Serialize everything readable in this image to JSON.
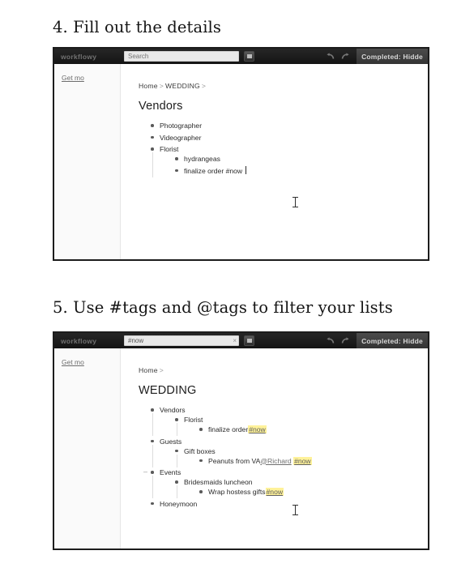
{
  "document": {
    "steps": [
      {
        "heading": "4. Fill out the details"
      },
      {
        "heading": "5. Use #tags and @tags to filter your lists"
      }
    ]
  },
  "screenshot_1": {
    "topbar": {
      "logo": "workflowy",
      "search_value": "",
      "search_placeholder": "Search",
      "search_clear_label": "",
      "undo_icon": "undo-arrow-icon",
      "redo_icon": "redo-arrow-icon",
      "menu_button_icon": "square-menu-icon",
      "completed_button": "Completed: Hidde"
    },
    "sidebar": {
      "link": "Get mo"
    },
    "breadcrumb": {
      "items": [
        "Home",
        "WEDDING"
      ],
      "separator": ">"
    },
    "title": "Vendors",
    "outline": [
      {
        "text": "Photographer",
        "indent": 0
      },
      {
        "text": "Videographer",
        "indent": 0
      },
      {
        "text": "Florist",
        "indent": 0
      },
      {
        "text": "hydrangeas",
        "indent": 1
      },
      {
        "text": "finalize order #now",
        "indent": 1,
        "caret": true
      }
    ]
  },
  "screenshot_2": {
    "topbar": {
      "logo": "workflowy",
      "search_value": "#now",
      "search_placeholder": "Search",
      "search_clear_label": "×",
      "undo_icon": "undo-arrow-icon",
      "redo_icon": "redo-arrow-icon",
      "menu_button_icon": "square-menu-icon",
      "completed_button": "Completed: Hidde"
    },
    "sidebar": {
      "link": "Get mo"
    },
    "breadcrumb": {
      "items": [
        "Home"
      ],
      "separator": ">"
    },
    "title": "WEDDING",
    "outline": [
      {
        "text": "Vendors",
        "indent": 0
      },
      {
        "text": "Florist",
        "indent": 1
      },
      {
        "text": "finalize order ",
        "tag": "#now",
        "indent": 2
      },
      {
        "text": "Guests",
        "indent": 0
      },
      {
        "text": "Gift boxes",
        "indent": 1
      },
      {
        "text": "Peanuts from VA ",
        "mention": "@Richard",
        "tag": "#now",
        "indent": 2
      },
      {
        "text": "Events",
        "indent": 0,
        "collapse_handle": "–"
      },
      {
        "text": "Bridesmaids luncheon",
        "indent": 1
      },
      {
        "text": "Wrap hostess gifts ",
        "tag": "#now",
        "indent": 2
      },
      {
        "text": "Honeymoon",
        "indent": 0,
        "clipped": true
      }
    ]
  },
  "colors": {
    "tag_highlight": "#fff29a",
    "topbar_background": "#1a1a1a",
    "frame_border": "#1c1c1c"
  }
}
